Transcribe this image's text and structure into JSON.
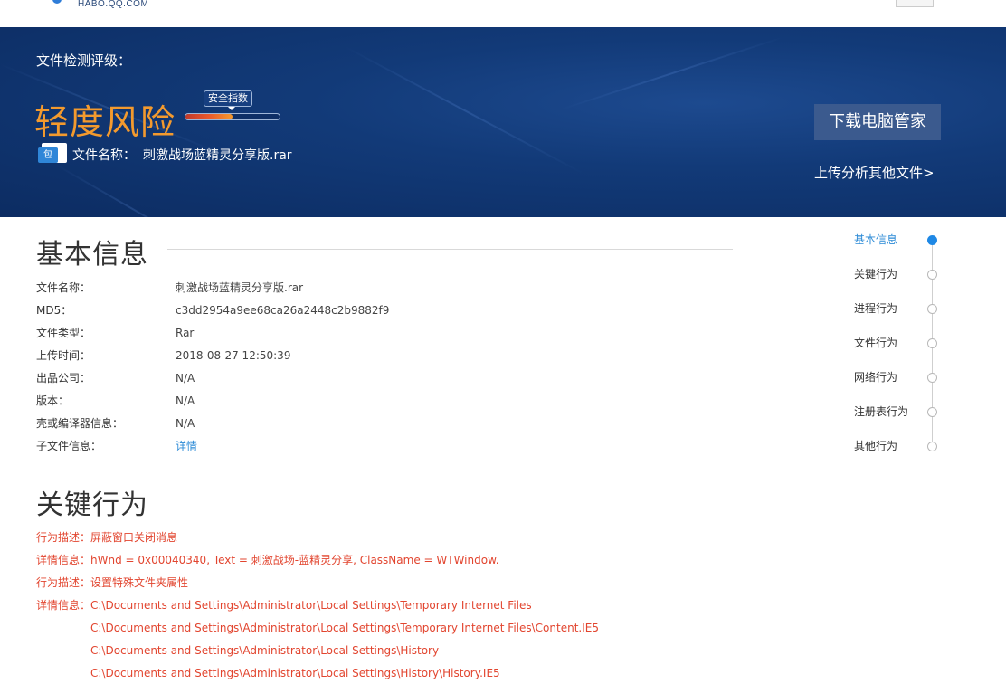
{
  "header": {
    "site_url": "HABO.QQ.COM"
  },
  "banner": {
    "rating_label": "文件检测评级：",
    "risk_level": "轻度风险",
    "safety_tag": "安全指数",
    "safety_index_fraction": 0.5,
    "file_icon_glyph": "包",
    "file_name_label": "文件名称：",
    "file_name_value": "刺激战场蓝精灵分享版.rar",
    "download_button": "下载电脑管家",
    "upload_link": "上传分析其他文件>",
    "colors": {
      "risk": "#f39a2e",
      "banner_bg": "#123a78",
      "button_bg": "#3b5a8e"
    }
  },
  "basic_info": {
    "title": "基本信息",
    "rows": [
      {
        "key": "文件名称：",
        "value": "刺激战场蓝精灵分享版.rar"
      },
      {
        "key": "MD5：",
        "value": "c3dd2954a9ee68ca26a2448c2b9882f9"
      },
      {
        "key": "文件类型：",
        "value": "Rar"
      },
      {
        "key": "上传时间：",
        "value": "2018-08-27 12:50:39"
      },
      {
        "key": "出品公司：",
        "value": "N/A"
      },
      {
        "key": "版本：",
        "value": "N/A"
      },
      {
        "key": "壳或编译器信息：",
        "value": "N/A"
      },
      {
        "key": "子文件信息：",
        "value": "详情"
      }
    ]
  },
  "key_behavior": {
    "title": "关键行为",
    "rows": [
      {
        "key": "行为描述：",
        "value": "屏蔽窗口关闭消息"
      },
      {
        "key": "详情信息：",
        "value": "hWnd = 0x00040340, Text = 刺激战场-蓝精灵分享, ClassName = WTWindow."
      },
      {
        "key": "行为描述：",
        "value": "设置特殊文件夹属性"
      },
      {
        "key": "详情信息：",
        "value": "C:\\Documents and Settings\\Administrator\\Local Settings\\Temporary Internet Files"
      },
      {
        "key": "",
        "value": "C:\\Documents and Settings\\Administrator\\Local Settings\\Temporary Internet Files\\Content.IE5"
      },
      {
        "key": "",
        "value": "C:\\Documents and Settings\\Administrator\\Local Settings\\History"
      },
      {
        "key": "",
        "value": "C:\\Documents and Settings\\Administrator\\Local Settings\\History\\History.IE5"
      }
    ],
    "color": "#e2452f"
  },
  "side_nav": {
    "items": [
      {
        "label": "基本信息",
        "active": true
      },
      {
        "label": "关键行为",
        "active": false
      },
      {
        "label": "进程行为",
        "active": false
      },
      {
        "label": "文件行为",
        "active": false
      },
      {
        "label": "网络行为",
        "active": false
      },
      {
        "label": "注册表行为",
        "active": false
      },
      {
        "label": "其他行为",
        "active": false
      }
    ],
    "active_color": "#1e88e5"
  }
}
